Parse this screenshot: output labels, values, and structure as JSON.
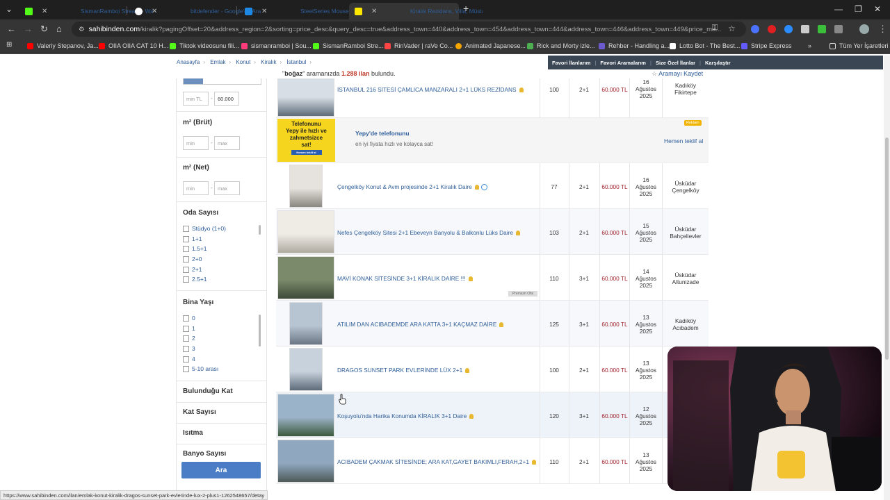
{
  "browser": {
    "tabs": [
      {
        "title": "SismanRamboi Stream - Watch",
        "color": "#53fc18"
      },
      {
        "title": "bitdefender - Google'da Ara",
        "color": "#ffffff"
      },
      {
        "title": "SteelSeries Mouse Fiyatları | En",
        "color": "#1e88e5"
      },
      {
        "title": "Kiralık Rezidans, Villa, Müstakil",
        "color": "#ffe800"
      }
    ],
    "new_tab": "+",
    "url_host": "sahibinden.com",
    "url_path": "/kiralik?pagingOffset=20&address_region=2&sorting=price_desc&query_desc=true&address_town=440&address_town=454&address_town=444&address_town=446&address_town=449&price_ma...",
    "bookmarks": [
      {
        "label": "Valeriy Stepanov, Ja...",
        "color": "#ff0000"
      },
      {
        "label": "OIIA OIIA CAT 10 H...",
        "color": "#ff0000"
      },
      {
        "label": "Tiktok videosunu fili...",
        "color": "#53fc18"
      },
      {
        "label": "sismanramboi | Sou...",
        "color": "#ff3b7a"
      },
      {
        "label": "SismanRamboi Stre...",
        "color": "#53fc18"
      },
      {
        "label": "RinVader | raVe Co...",
        "color": "#ff4444"
      },
      {
        "label": "Animated Japanese...",
        "color": "#f7a600"
      },
      {
        "label": "Rick and Morty izle...",
        "color": "#4caf50"
      },
      {
        "label": "Rehber - Handling a...",
        "color": "#6a5acd"
      },
      {
        "label": "Lotto Bot - The Best...",
        "color": "#ffffff"
      },
      {
        "label": "Stripe Express",
        "color": "#635bff"
      }
    ],
    "bookmarks_more": "»",
    "all_bookmarks": "Tüm Yer İşaretleri",
    "status_url": "https://www.sahibinden.com/ilan/emlak-konut-kiralik-dragos-sunset-park-evlerinde-lux-2-plus1-1262548657/detay"
  },
  "header": {
    "breadcrumbs": [
      "Anasayfa",
      "Emlak",
      "Konut",
      "Kiralık",
      "İstanbul"
    ],
    "topnav": [
      "Favori İlanlarım",
      "Favori Aramalarım",
      "Size Özel İlanlar",
      "Karşılaştır"
    ],
    "query_word": "boğaz",
    "query_mid": "aramanızda",
    "result_count": "1.288 ilan",
    "result_suffix": "bulundu.",
    "save_search": "Aramayı Kaydet"
  },
  "filters": {
    "price_min_placeholder": "min TL",
    "price_max_value": "60.000",
    "dash": "-",
    "m2_brut": "m² (Brüt)",
    "m2_net": "m² (Net)",
    "min_placeholder": "min",
    "max_placeholder": "max",
    "oda_title": "Oda Sayısı",
    "oda_options": [
      "Stüdyo (1+0)",
      "1+1",
      "1.5+1",
      "2+0",
      "2+1",
      "2.5+1"
    ],
    "bina_title": "Bina Yaşı",
    "bina_options": [
      "0",
      "1",
      "2",
      "3",
      "4",
      "5-10 arası"
    ],
    "kat_title": "Bulunduğu Kat",
    "katsayisi_title": "Kat Sayısı",
    "isitma_title": "Isıtma",
    "banyo_title": "Banyo Sayısı",
    "search_button": "Ara"
  },
  "ad": {
    "image_line1": "Telefonunu",
    "image_line2": "Yepy ile hızlı ve",
    "image_line3": "zahmetsizce",
    "image_line4": "sat!",
    "image_btn": "Hemen teklif al",
    "title": "Yepy'de telefonunu",
    "subtitle": "en iyi fiyata hızlı ve kolayca sat!",
    "badge": "Reklam",
    "cta": "Hemen teklif al"
  },
  "premium_label": "Premium Ofis",
  "listings": [
    {
      "title": "İSTANBUL 216 SİTESİ ÇAMLICA MANZARALI 2+1 LÜKS REZİDANS",
      "m2": "100",
      "rooms": "2+1",
      "price": "60.000 TL",
      "date_day": "16",
      "date_month": "Ağustos",
      "date_year": "2025",
      "district": "Kadıköy",
      "neighborhood": "Fikirtepe"
    },
    {
      "title": "Çengelköy Konut & Avm projesinde 2+1 Kiralık Daire",
      "m2": "77",
      "rooms": "2+1",
      "price": "60.000 TL",
      "date_day": "16",
      "date_month": "Ağustos",
      "date_year": "2025",
      "district": "Üsküdar",
      "neighborhood": "Çengelköy"
    },
    {
      "title": "Nefes Çengelköy Sitesi 2+1 Ebeveyn Banyolu & Balkonlu Lüks Daire",
      "m2": "103",
      "rooms": "2+1",
      "price": "60.000 TL",
      "date_day": "15",
      "date_month": "Ağustos",
      "date_year": "2025",
      "district": "Üsküdar",
      "neighborhood": "Bahçelievler"
    },
    {
      "title": "MAVİ KONAK SİTESİNDE 3+1 KİRALIK DAİRE !!!",
      "m2": "110",
      "rooms": "3+1",
      "price": "60.000 TL",
      "date_day": "14",
      "date_month": "Ağustos",
      "date_year": "2025",
      "district": "Üsküdar",
      "neighborhood": "Altunizade"
    },
    {
      "title": "ATILIM DAN ACIBADEMDE ARA KATTA 3+1 KAÇMAZ DAİRE",
      "m2": "125",
      "rooms": "3+1",
      "price": "60.000 TL",
      "date_day": "13",
      "date_month": "Ağustos",
      "date_year": "2025",
      "district": "Kadıköy",
      "neighborhood": "Acıbadem"
    },
    {
      "title": "DRAGOS SUNSET PARK EVLERİNDE LÜX 2+1",
      "m2": "100",
      "rooms": "2+1",
      "price": "60.000 TL",
      "date_day": "13",
      "date_month": "Ağustos",
      "date_year": "2025",
      "district": "",
      "neighborhood": ""
    },
    {
      "title": "Koşuyolu'nda Harika Konumda KİRALIK 3+1 Daire",
      "m2": "120",
      "rooms": "3+1",
      "price": "60.000 TL",
      "date_day": "12",
      "date_month": "Ağustos",
      "date_year": "2025",
      "district": "",
      "neighborhood": ""
    },
    {
      "title": "ACIBADEM ÇAKMAK SİTESİNDE; ARA KAT,GAYET BAKIMLI,FERAH,2+1",
      "m2": "110",
      "rooms": "2+1",
      "price": "60.000 TL",
      "date_day": "13",
      "date_month": "Ağustos",
      "date_year": "2025",
      "district": "",
      "neighborhood": ""
    }
  ],
  "colors": {
    "link_blue": "#2e5d98",
    "price_red": "#a0232b",
    "search_button_blue": "#4a7dc6",
    "browser_dark": "#1f1f1f"
  }
}
